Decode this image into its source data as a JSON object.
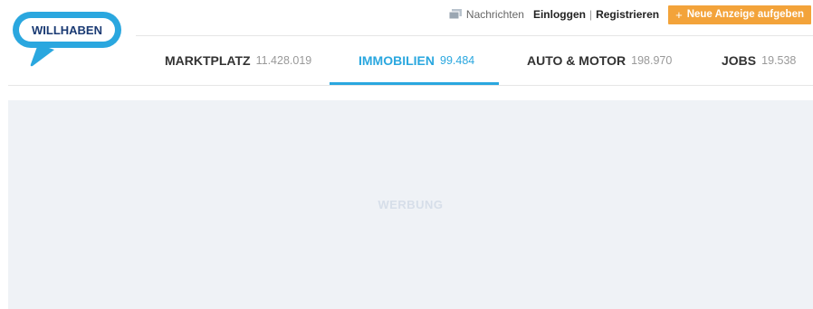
{
  "header": {
    "logo_text": "WILLHABEN",
    "nachrichten_label": "Nachrichten",
    "login_label": "Einloggen",
    "separator": "|",
    "register_label": "Registrieren",
    "new_ad_plus": "+",
    "new_ad_label": "Neue Anzeige aufgeben"
  },
  "nav": {
    "tabs": [
      {
        "label": "MARKTPLATZ",
        "count": "11.428.019",
        "active": false
      },
      {
        "label": "IMMOBILIEN",
        "count": "99.484",
        "active": true
      },
      {
        "label": "AUTO & MOTOR",
        "count": "198.970",
        "active": false
      },
      {
        "label": "JOBS",
        "count": "19.538",
        "active": false
      }
    ]
  },
  "ad": {
    "label": "WERBUNG"
  },
  "colors": {
    "brand_blue": "#2aa7df",
    "cta_orange": "#f3a33a",
    "ad_background": "#eff2f6"
  },
  "icons": {
    "logo": "willhaben-logo-icon",
    "messages": "messages-icon"
  }
}
